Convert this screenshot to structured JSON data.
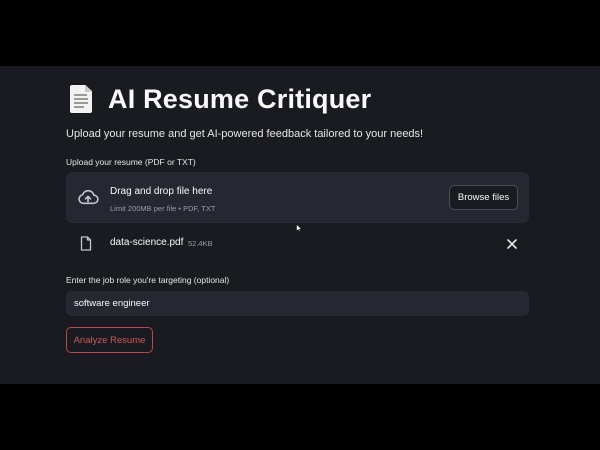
{
  "app": {
    "title": "AI Resume Critiquer",
    "title_icon": "page-facing-up-emoji",
    "subtitle": "Upload your resume and get AI-powered feedback tailored to your needs!"
  },
  "uploader": {
    "label": "Upload your resume (PDF or TXT)",
    "drop_text": "Drag and drop file here",
    "limit_text": "Limit 200MB per file • PDF, TXT",
    "browse_label": "Browse files",
    "icon": "cloud-upload-icon"
  },
  "uploaded_file": {
    "name": "data-science.pdf",
    "size": "52.4KB",
    "icon": "file-icon",
    "remove_icon": "close-icon"
  },
  "job_role": {
    "label": "Enter the job role you're targeting (optional)",
    "value": "software engineer",
    "placeholder": ""
  },
  "actions": {
    "analyze_label": "Analyze Resume"
  },
  "colors": {
    "background": "#191b20",
    "surface": "#262730",
    "accent": "#c9595f",
    "text": "#fafafa",
    "muted": "#9a9ba3"
  }
}
